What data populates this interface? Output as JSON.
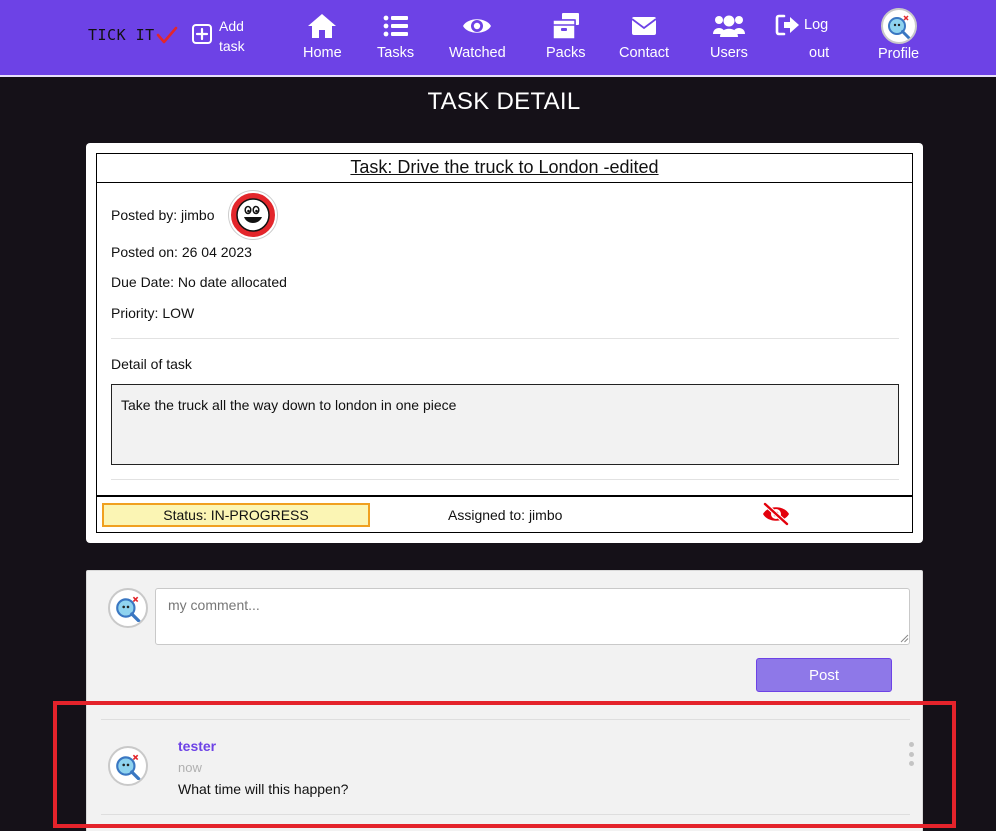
{
  "nav": {
    "brand": "TICK IT",
    "add_task": "Add task",
    "add_task_l1": "Add",
    "add_task_l2": "task",
    "items": [
      {
        "label": "Home",
        "icon": "home-icon"
      },
      {
        "label": "Tasks",
        "icon": "list-icon"
      },
      {
        "label": "Watched",
        "icon": "eye-icon"
      },
      {
        "label": "Packs",
        "icon": "boxes-icon"
      },
      {
        "label": "Contact",
        "icon": "envelope-icon"
      },
      {
        "label": "Users",
        "icon": "users-icon"
      }
    ],
    "logout_l1": "Log",
    "logout_l2": "out",
    "profile": "Profile",
    "accent_color": "#6d42e6"
  },
  "page_title": "TASK DETAIL",
  "task": {
    "title": "Task: Drive the truck to London -edited",
    "posted_by": "Posted by: jimbo",
    "posted_on": "Posted on: 26 04 2023",
    "due_date": "Due Date: No date allocated",
    "priority": "Priority: LOW",
    "detail_label": "Detail of task",
    "detail_text": "Take the truck all the way down to london in one piece",
    "status": "Status: IN-PROGRESS",
    "assigned_to": "Assigned to: jimbo",
    "watch_icon": "eye-slash-icon",
    "status_color": "#fbf5b4"
  },
  "comments": {
    "input_placeholder": "my comment...",
    "post_label": "Post",
    "items": [
      {
        "author": "tester",
        "time": "now",
        "text": "What time will this happen?"
      }
    ]
  }
}
